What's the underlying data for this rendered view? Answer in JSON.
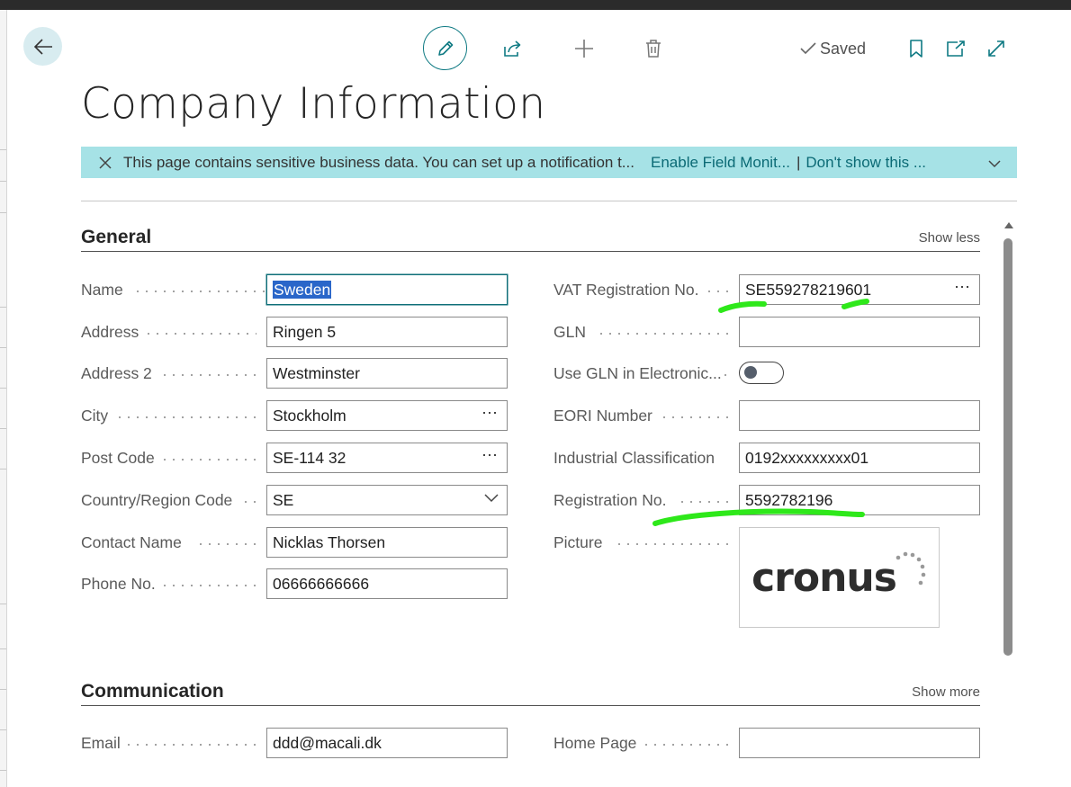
{
  "page": {
    "title": "Company Information"
  },
  "actions": {
    "saved_label": "Saved"
  },
  "notification": {
    "message": "This page contains sensitive business data. You can set up a notification t...",
    "link_enable": "Enable Field Monit...",
    "separator": "|",
    "link_dismiss": "Don't show this ..."
  },
  "general": {
    "title": "General",
    "toggle_label": "Show less",
    "left": [
      {
        "label": "Name",
        "value": "Sweden"
      },
      {
        "label": "Address",
        "value": "Ringen 5"
      },
      {
        "label": "Address 2",
        "value": "Westminster"
      },
      {
        "label": "City",
        "value": "Stockholm"
      },
      {
        "label": "Post Code",
        "value": "SE-114 32"
      },
      {
        "label": "Country/Region Code",
        "value": "SE"
      },
      {
        "label": "Contact Name",
        "value": "Nicklas Thorsen"
      },
      {
        "label": "Phone No.",
        "value": "06666666666"
      }
    ],
    "right": [
      {
        "label": "VAT Registration No.",
        "value": "SE559278219601"
      },
      {
        "label": "GLN",
        "value": ""
      },
      {
        "label": "Use GLN in Electronic...",
        "value": "off"
      },
      {
        "label": "EORI Number",
        "value": ""
      },
      {
        "label": "Industrial Classification",
        "value": "0192xxxxxxxxx01"
      },
      {
        "label": "Registration No.",
        "value": "5592782196"
      },
      {
        "label": "Picture",
        "value": "cronus"
      }
    ],
    "ellipsis": "⋯"
  },
  "communication": {
    "title": "Communication",
    "toggle_label": "Show more",
    "left": [
      {
        "label": "Email",
        "value": "ddd@macali.dk"
      }
    ],
    "right": [
      {
        "label": "Home Page",
        "value": ""
      }
    ]
  },
  "colors": {
    "accent": "#0f7a83",
    "banner": "#a6e2e6",
    "highlight": "#2ee81a"
  }
}
